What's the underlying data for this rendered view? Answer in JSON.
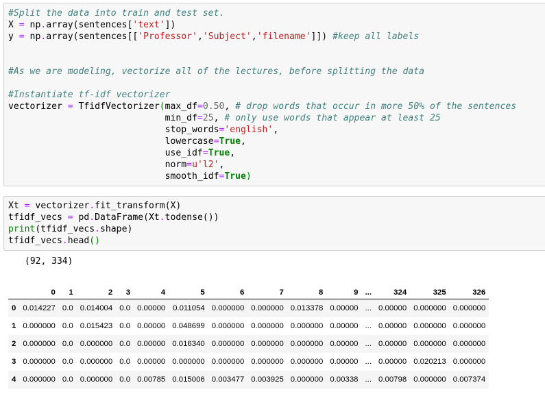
{
  "cell1": {
    "l1_comment": "#Split the data into train and test set.",
    "l2_a": "X ",
    "l2_eq": "=",
    "l2_b": " np",
    "l2_dot": ".",
    "l2_c": "array(sentences[",
    "l2_s": "'text'",
    "l2_d": "])",
    "l3_a": "y ",
    "l3_eq": "=",
    "l3_b": " np",
    "l3_dot": ".",
    "l3_c": "array(sentences[[",
    "l3_s1": "'Professor'",
    "l3_c1": ",",
    "l3_s2": "'Subject'",
    "l3_c2": ",",
    "l3_s3": "'filename'",
    "l3_d": "]]) ",
    "l3_comment": "#keep all labels",
    "l6_comment": "#As we are modeling, vectorize all of the lectures, before splitting the data",
    "l8_comment": "#Instantiate tf-idf vectorizer",
    "l9_a": "vectorizer ",
    "l9_eq": "=",
    "l9_b": " TfidfVectorizer",
    "l9_p": "(",
    "l9_c": "max_df",
    "l9_eq2": "=",
    "l9_num": "0.50",
    "l9_d": ", ",
    "l9_comment": "# drop words that occur in more 50% of the sentences",
    "l10_pad": "                             ",
    "l10_a": "min_df",
    "l10_eq": "=",
    "l10_num": "25",
    "l10_b": ", ",
    "l10_comment": "# only use words that appear at least 25",
    "l11_pad": "                             ",
    "l11_a": "stop_words",
    "l11_eq": "=",
    "l11_s": "'english'",
    "l11_b": ",",
    "l12_pad": "                             ",
    "l12_a": "lowercase",
    "l12_eq": "=",
    "l12_k": "True",
    "l12_b": ",",
    "l13_pad": "                             ",
    "l13_a": "use_idf",
    "l13_eq": "=",
    "l13_k": "True",
    "l13_b": ",",
    "l14_pad": "                             ",
    "l14_a": "norm",
    "l14_eq": "=",
    "l14_s": "u'l2'",
    "l14_b": ",",
    "l15_pad": "                             ",
    "l15_a": "smooth_idf",
    "l15_eq": "=",
    "l15_k": "True",
    "l15_p": ")"
  },
  "cell2": {
    "l1_a": "Xt ",
    "l1_eq": "=",
    "l1_b": " vectorizer",
    "l1_dot": ".",
    "l1_c": "fit_transform(X)",
    "l2_a": "tfidf_vecs ",
    "l2_eq": "=",
    "l2_b": " pd",
    "l2_dot": ".",
    "l2_c": "DataFrame(Xt",
    "l2_dot2": ".",
    "l2_d": "todense())",
    "l3_print": "print",
    "l3_a": "(tfidf_vecs",
    "l3_dot": ".",
    "l3_b": "shape)",
    "l4_a": "tfidf_vecs",
    "l4_dot": ".",
    "l4_b": "head",
    "l4_p": "()"
  },
  "output": {
    "stdout": "(92, 334)"
  },
  "dataframe": {
    "columns": [
      "",
      "0",
      "1",
      "2",
      "3",
      "4",
      "5",
      "6",
      "7",
      "8",
      "9",
      "...",
      "324",
      "325",
      "326"
    ],
    "rows": [
      [
        "0",
        "0.014227",
        "0.0",
        "0.014004",
        "0.0",
        "0.00000",
        "0.011054",
        "0.000000",
        "0.000000",
        "0.013378",
        "0.00000",
        "...",
        "0.00000",
        "0.000000",
        "0.000000"
      ],
      [
        "1",
        "0.000000",
        "0.0",
        "0.015423",
        "0.0",
        "0.00000",
        "0.048699",
        "0.000000",
        "0.000000",
        "0.000000",
        "0.00000",
        "...",
        "0.00000",
        "0.000000",
        "0.000000"
      ],
      [
        "2",
        "0.000000",
        "0.0",
        "0.000000",
        "0.0",
        "0.00000",
        "0.016340",
        "0.000000",
        "0.000000",
        "0.000000",
        "0.00000",
        "...",
        "0.00000",
        "0.000000",
        "0.000000"
      ],
      [
        "3",
        "0.000000",
        "0.0",
        "0.000000",
        "0.0",
        "0.00000",
        "0.000000",
        "0.000000",
        "0.000000",
        "0.000000",
        "0.00000",
        "...",
        "0.00000",
        "0.020213",
        "0.000000"
      ],
      [
        "4",
        "0.000000",
        "0.0",
        "0.000000",
        "0.0",
        "0.00785",
        "0.015006",
        "0.003477",
        "0.003925",
        "0.000000",
        "0.00338",
        "...",
        "0.00798",
        "0.000000",
        "0.007374"
      ]
    ]
  }
}
